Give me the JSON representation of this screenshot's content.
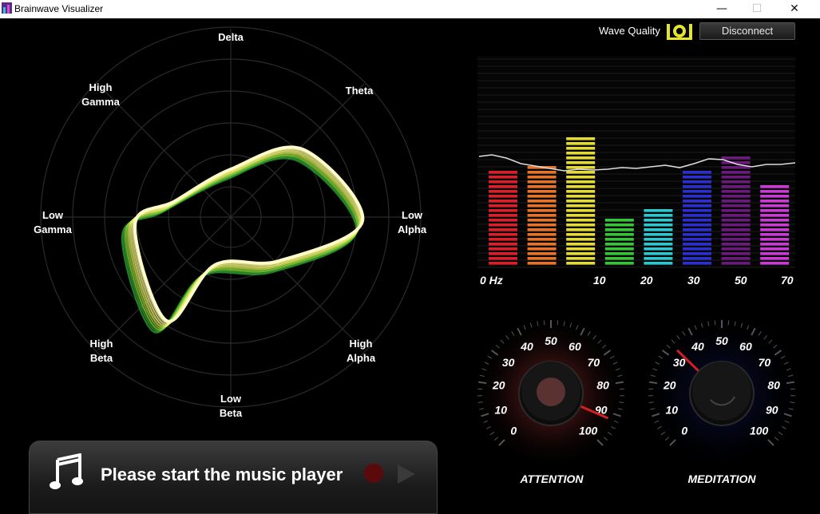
{
  "window": {
    "title": "Brainwave Visualizer",
    "minimize_glyph": "—",
    "maximize_glyph": "☐",
    "close_glyph": "✕"
  },
  "header": {
    "wave_quality_label": "Wave Quality",
    "wave_quality_icon": "signal-quality-icon",
    "disconnect_label": "Disconnect"
  },
  "radar": {
    "labels": {
      "delta": "Delta",
      "theta": "Theta",
      "low_alpha": [
        "Low",
        "Alpha"
      ],
      "high_alpha": [
        "High",
        "Alpha"
      ],
      "low_beta": [
        "Low",
        "Beta"
      ],
      "high_beta": [
        "High",
        "Beta"
      ],
      "low_gamma": [
        "Low",
        "Gamma"
      ],
      "high_gamma": [
        "High",
        "Gamma"
      ]
    },
    "ring_count": 6,
    "trail_colors": [
      "#2fa833",
      "#8fd33a",
      "#d7ea52",
      "#f3f47b",
      "#fffcc8"
    ]
  },
  "spectrum": {
    "hz_labels": [
      "0 Hz",
      "10",
      "20",
      "30",
      "50",
      "70"
    ],
    "bars": [
      {
        "value": 0.62,
        "color": "#d81f2a"
      },
      {
        "value": 0.66,
        "color": "#e5732a"
      },
      {
        "value": 0.85,
        "color": "#e3da3a"
      },
      {
        "value": 0.3,
        "color": "#38c43a"
      },
      {
        "value": 0.35,
        "color": "#2ec6cf"
      },
      {
        "value": 0.62,
        "color": "#2b2fd0"
      },
      {
        "value": 0.7,
        "color": "#6a1a7a"
      },
      {
        "value": 0.53,
        "color": "#c83cd4"
      }
    ]
  },
  "gauges": [
    {
      "id": "attention",
      "label": "ATTENTION",
      "value": 92,
      "ticks": [
        "0",
        "10",
        "20",
        "30",
        "40",
        "50",
        "60",
        "70",
        "80",
        "90",
        "100"
      ],
      "glow": "#8a2a2a",
      "needle": "#d42020"
    },
    {
      "id": "meditation",
      "label": "MEDITATION",
      "value": 33,
      "ticks": [
        "0",
        "10",
        "20",
        "30",
        "40",
        "50",
        "60",
        "70",
        "80",
        "90",
        "100"
      ],
      "glow": "#0d1450",
      "needle": "#d42020"
    }
  ],
  "music_player": {
    "message": "Please start the music player",
    "icon": "music-note-icon",
    "record_icon": "record-icon",
    "play_icon": "play-icon"
  }
}
